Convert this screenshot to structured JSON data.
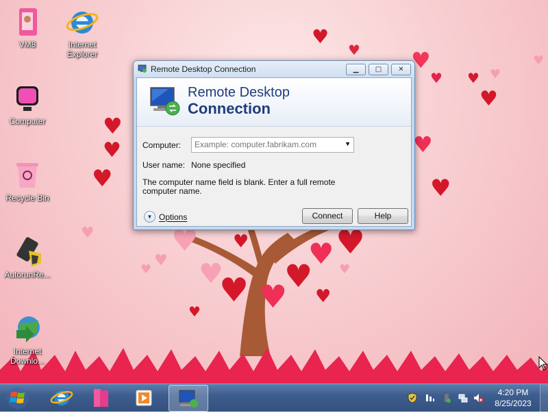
{
  "desktop": {
    "icons": [
      {
        "label": "VM8"
      },
      {
        "label": "Internet Explorer"
      },
      {
        "label": "Computer"
      },
      {
        "label": "Recycle Bin"
      },
      {
        "label": "AutorunRe..."
      },
      {
        "label": "Internet Downlo..."
      }
    ]
  },
  "window": {
    "title": "Remote Desktop Connection",
    "banner_line1": "Remote Desktop",
    "banner_line2": "Connection",
    "computer_label": "Computer:",
    "computer_placeholder": "Example: computer.fabrikam.com",
    "username_label": "User name:",
    "username_value": "None specified",
    "message": "The computer name field is blank. Enter a full remote computer name.",
    "options_label": "Options",
    "connect_label": "Connect",
    "help_label": "Help"
  },
  "taskbar": {
    "time": "4:20 PM",
    "date": "8/25/2023"
  },
  "icons": [
    "windows-logo-icon",
    "internet-explorer-icon",
    "file-explorer-icon",
    "media-player-icon",
    "remote-desktop-icon",
    "shield-icon",
    "network-icon",
    "volume-muted-icon"
  ]
}
